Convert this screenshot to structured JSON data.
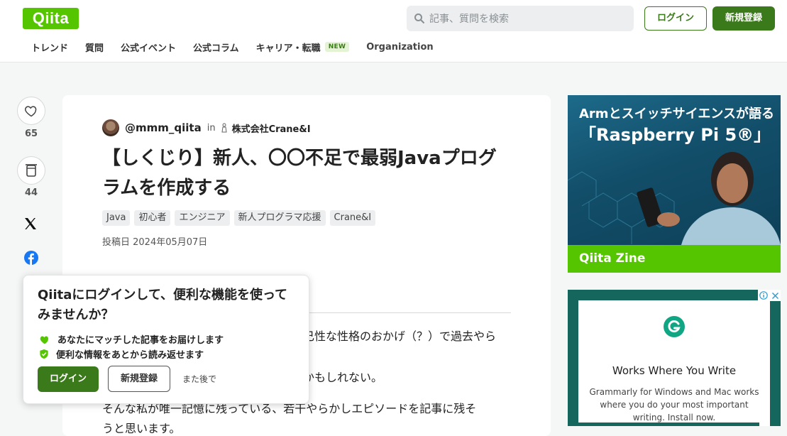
{
  "header": {
    "logo": "Qiita",
    "search_placeholder": "記事、質問を検索",
    "login_label": "ログイン",
    "signup_label": "新規登録",
    "nav": [
      {
        "label": "トレンド"
      },
      {
        "label": "質問"
      },
      {
        "label": "公式イベント"
      },
      {
        "label": "公式コラム"
      },
      {
        "label": "キャリア・転職",
        "badge": "NEW"
      },
      {
        "label": "Organization"
      }
    ]
  },
  "actions": {
    "likes": "65",
    "stocks": "44"
  },
  "article": {
    "author": "@mmm_qiita",
    "in_label": "in",
    "organization": "株式会社Crane&I",
    "title": "【しくじり】新人、〇〇不足で最弱Javaプログラムを作成する",
    "tags": [
      "Java",
      "初心者",
      "エンジニア",
      "新人プログラマ応援",
      "Crane&I"
    ],
    "posted": "投稿日 2024年05月07日",
    "body_fragments": [
      "己性な性格のおかげ（？）で過去やら",
      "かもしれない。",
      "そんな私が唯一記憶に残っている、若干やらかしエピソードを記事に残そ",
      "うと思います。"
    ]
  },
  "login_popup": {
    "title": "Qiitaにログインして、便利な機能を使ってみませんか？",
    "benefits": [
      "あなたにマッチした記事をお届けします",
      "便利な情報をあとから読み返せます"
    ],
    "login_label": "ログイン",
    "signup_label": "新規登録",
    "later_label": "また後で"
  },
  "ads": {
    "zine": {
      "line1": "Armとスイッチサイエンスが語る",
      "line2": "「Raspberry Pi 5®」",
      "brand": "Qiita Zine",
      "colors": {
        "brand_bar": "#55c500"
      }
    },
    "grammarly": {
      "headline": "Works Where You Write",
      "body": "Grammarly for Windows and Mac works where you do your most important writing. Install now."
    }
  },
  "colors": {
    "brand_green": "#55c500",
    "button_green": "#3b7a1a",
    "background": "#f5f6f6"
  }
}
